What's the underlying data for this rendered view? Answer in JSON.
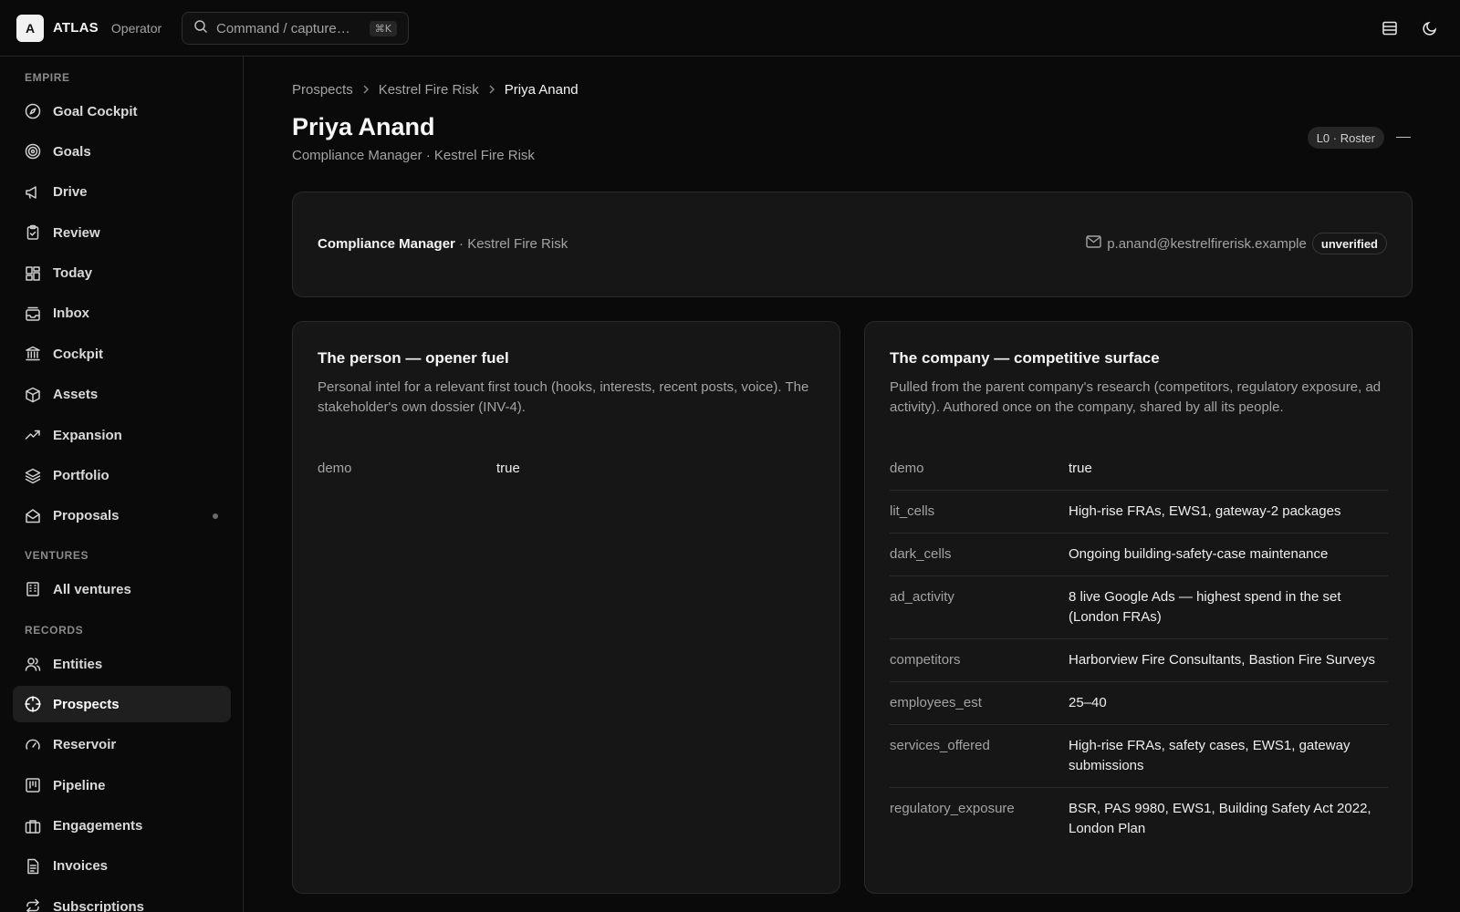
{
  "app": {
    "logo_letter": "A",
    "name": "ATLAS",
    "role": "Operator",
    "search_placeholder": "Command / capture…",
    "search_shortcut": "⌘K"
  },
  "sidebar": {
    "sections": [
      {
        "label": "EMPIRE",
        "items": [
          {
            "label": "Goal Cockpit",
            "icon": "compass-icon"
          },
          {
            "label": "Goals",
            "icon": "target-icon"
          },
          {
            "label": "Drive",
            "icon": "megaphone-icon"
          },
          {
            "label": "Review",
            "icon": "clipboard-check-icon"
          },
          {
            "label": "Today",
            "icon": "dashboard-icon"
          },
          {
            "label": "Inbox",
            "icon": "inbox-stack-icon"
          },
          {
            "label": "Cockpit",
            "icon": "bank-icon"
          },
          {
            "label": "Assets",
            "icon": "package-icon"
          },
          {
            "label": "Expansion",
            "icon": "trending-up-icon"
          },
          {
            "label": "Portfolio",
            "icon": "layers-icon"
          },
          {
            "label": "Proposals",
            "icon": "mail-open-icon",
            "dot": true
          }
        ]
      },
      {
        "label": "VENTURES",
        "items": [
          {
            "label": "All ventures",
            "icon": "building-icon"
          }
        ]
      },
      {
        "label": "RECORDS",
        "items": [
          {
            "label": "Entities",
            "icon": "users-icon"
          },
          {
            "label": "Prospects",
            "icon": "crosshair-icon",
            "active": true
          },
          {
            "label": "Reservoir",
            "icon": "gauge-icon"
          },
          {
            "label": "Pipeline",
            "icon": "kanban-icon"
          },
          {
            "label": "Engagements",
            "icon": "briefcase-icon"
          },
          {
            "label": "Invoices",
            "icon": "file-text-icon"
          },
          {
            "label": "Subscriptions",
            "icon": "repeat-icon"
          }
        ]
      }
    ]
  },
  "breadcrumb": [
    "Prospects",
    "Kestrel Fire Risk",
    "Priya Anand"
  ],
  "header": {
    "title": "Priya Anand",
    "subtitle": "Compliance Manager · Kestrel Fire Risk",
    "tier_badge": "L0 · Roster"
  },
  "summary": {
    "role": "Compliance Manager",
    "company": "· Kestrel Fire Risk",
    "email": "p.anand@kestrelfirerisk.example",
    "email_status": "unverified"
  },
  "person_panel": {
    "title": "The person — opener fuel",
    "description": "Personal intel for a relevant first touch (hooks, interests, recent posts, voice). The stakeholder's own dossier (INV-4).",
    "rows": [
      {
        "key": "demo",
        "value": "true"
      }
    ]
  },
  "company_panel": {
    "title": "The company — competitive surface",
    "description": "Pulled from the parent company's research (competitors, regulatory exposure, ad activity). Authored once on the company, shared by all its people.",
    "rows": [
      {
        "key": "demo",
        "value": "true"
      },
      {
        "key": "lit_cells",
        "value": "High-rise FRAs, EWS1, gateway-2 packages"
      },
      {
        "key": "dark_cells",
        "value": "Ongoing building-safety-case maintenance"
      },
      {
        "key": "ad_activity",
        "value": "8 live Google Ads — highest spend in the set (London FRAs)"
      },
      {
        "key": "competitors",
        "value": "Harborview Fire Consultants, Bastion Fire Surveys"
      },
      {
        "key": "employees_est",
        "value": "25–40"
      },
      {
        "key": "services_offered",
        "value": "High-rise FRAs, safety cases, EWS1, gateway submissions"
      },
      {
        "key": "regulatory_exposure",
        "value": "BSR, PAS 9980, EWS1, Building Safety Act 2022, London Plan"
      }
    ]
  }
}
